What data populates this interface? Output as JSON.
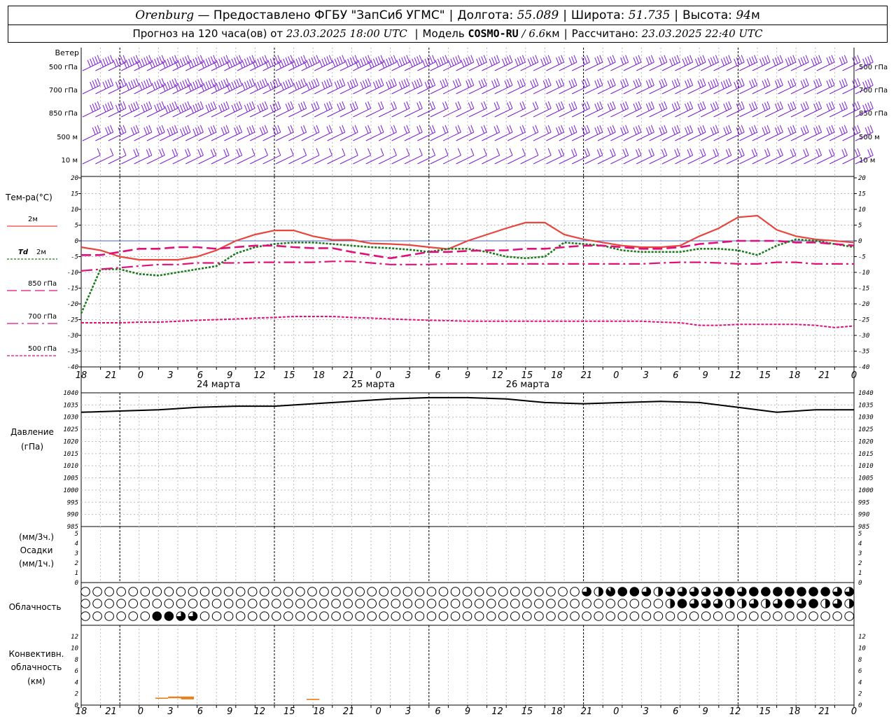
{
  "header": {
    "city": "Orenburg",
    "provider": "— Предоставлено ФГБУ \"ЗапСиб УГМС\"",
    "lon_label": "Долгота:",
    "lon": "55.089",
    "lat_label": "Широта:",
    "lat": "51.735",
    "alt_label": "Высота:",
    "alt": "94",
    "alt_unit": "м",
    "forecast_prefix": "Прогноз на 120 часа(ов) от",
    "forecast_start": "23.03.2025 18:00 UTC",
    "model_label": "Модель",
    "model": "COSMO-RU",
    "resolution_sep": "/",
    "resolution": "6.6",
    "resolution_unit": "км",
    "computed_label": "Рассчитано:",
    "computed": "23.03.2025 22:40 UTC"
  },
  "colors": {
    "t2m": "#e8453c",
    "td2m": "#1a7a1a",
    "t850": "#e0107a",
    "t700": "#e0107a",
    "t500": "#e0107a",
    "zero_line": "#4466dd",
    "wind": "#7a1ad4",
    "pressure": "#000000",
    "convective": "#e88020",
    "grid": "#000000"
  },
  "time_axis": {
    "hour_ticks": [
      "18",
      "21",
      "0",
      "3",
      "6",
      "9",
      "12",
      "15",
      "18",
      "21",
      "0",
      "3",
      "6",
      "9",
      "12",
      "15",
      "18",
      "21",
      "0",
      "3",
      "6",
      "9",
      "12",
      "15",
      "18",
      "21",
      "0"
    ],
    "day_labels": [
      "24 марта",
      "25 марта",
      "26 марта"
    ]
  },
  "chart_data": [
    {
      "type": "barbs",
      "title": "Ветер",
      "levels": [
        "500 гПа",
        "700 гПа",
        "850 гПа",
        "500 м",
        "10 м"
      ],
      "x_hours": [
        0,
        6,
        12,
        18,
        24,
        30,
        36,
        42,
        48,
        54,
        60,
        66,
        72,
        78,
        84,
        90,
        96,
        102,
        108,
        114,
        120
      ],
      "speed_ms": [
        [
          18,
          22,
          25,
          25,
          24,
          22,
          20,
          22,
          20,
          18,
          16,
          14,
          12,
          12,
          12,
          14,
          14,
          14,
          14,
          12,
          14
        ],
        [
          16,
          20,
          22,
          22,
          20,
          18,
          16,
          16,
          14,
          12,
          10,
          10,
          10,
          10,
          12,
          12,
          14,
          12,
          12,
          12,
          14
        ],
        [
          14,
          16,
          18,
          16,
          14,
          12,
          10,
          8,
          8,
          6,
          6,
          8,
          10,
          10,
          12,
          12,
          12,
          10,
          10,
          12,
          14
        ],
        [
          10,
          12,
          14,
          12,
          10,
          8,
          8,
          6,
          6,
          6,
          8,
          8,
          10,
          10,
          10,
          12,
          12,
          12,
          10,
          10,
          12
        ],
        [
          5,
          6,
          7,
          6,
          5,
          5,
          4,
          4,
          4,
          3,
          4,
          5,
          6,
          6,
          6,
          7,
          7,
          6,
          6,
          6,
          7
        ]
      ]
    },
    {
      "type": "line",
      "title": "Тем-ра(°С)",
      "ylim": [
        -40,
        20
      ],
      "y_ticks": [
        "20",
        "15",
        "10",
        "5",
        "0",
        "-5",
        "-10",
        "-15",
        "-20",
        "-25",
        "-30",
        "-35",
        "-40"
      ],
      "x_hours": [
        0,
        3,
        6,
        9,
        12,
        15,
        18,
        21,
        24,
        27,
        30,
        33,
        36,
        39,
        42,
        45,
        48,
        51,
        54,
        57,
        60,
        63,
        66,
        69,
        72,
        75,
        78,
        81,
        84,
        87,
        90,
        93,
        96,
        99,
        102,
        105,
        108,
        111,
        114,
        117,
        120
      ],
      "series": [
        {
          "name": "2м",
          "values": [
            -2,
            -3,
            -5,
            -6,
            -6,
            -6,
            -5,
            -3,
            0,
            2,
            3.3,
            3.3,
            1.5,
            0.3,
            0.3,
            -0.8,
            -1,
            -1.3,
            -2,
            -2.6,
            0,
            2,
            4,
            5.8,
            5.8,
            2,
            0.5,
            -0.5,
            -1.5,
            -2,
            -2,
            -1.5,
            1.5,
            4,
            7.5,
            8,
            3.5,
            1.5,
            0.5,
            0,
            -0.5
          ]
        },
        {
          "name": "Td 2м",
          "values": [
            -23,
            -9,
            -9,
            -10.5,
            -11,
            -10,
            -9,
            -8,
            -4,
            -2,
            -1,
            -0.5,
            -0.5,
            -1,
            -1.5,
            -2,
            -2.3,
            -2.8,
            -3.5,
            -2.5,
            -2.5,
            -3.5,
            -5,
            -5.5,
            -5,
            -0.5,
            -1,
            -1.5,
            -3,
            -3.5,
            -3.5,
            -3.5,
            -2.5,
            -2.5,
            -3,
            -4.5,
            -1.5,
            0.5,
            0,
            -1,
            -2
          ]
        },
        {
          "name": "850 гПа",
          "values": [
            -4.5,
            -4.5,
            -3.5,
            -2.5,
            -2.5,
            -2,
            -2,
            -2.5,
            -2,
            -1.5,
            -1.5,
            -2,
            -2.3,
            -2.3,
            -3.5,
            -4.5,
            -5.5,
            -4.5,
            -3.5,
            -3.5,
            -3.2,
            -3,
            -3,
            -2.5,
            -2.5,
            -2,
            -1.5,
            -1.5,
            -2,
            -2.5,
            -2.5,
            -2,
            -1,
            -0.5,
            0,
            0,
            0,
            -0.5,
            -0.5,
            -1,
            -1.5
          ]
        },
        {
          "name": "700 гПа",
          "values": [
            -9.5,
            -9,
            -8.5,
            -8,
            -7.5,
            -7.5,
            -7,
            -7,
            -7,
            -6.8,
            -6.8,
            -6.8,
            -6.8,
            -6.5,
            -6.5,
            -7,
            -7.5,
            -7.5,
            -7.5,
            -7.3,
            -7.3,
            -7.3,
            -7.3,
            -7.3,
            -7.3,
            -7.3,
            -7.3,
            -7.3,
            -7.3,
            -7.3,
            -7,
            -6.8,
            -6.8,
            -7,
            -7.3,
            -7.3,
            -6.8,
            -6.8,
            -7.3,
            -7.3,
            -7.3
          ]
        },
        {
          "name": "500 гПа",
          "values": [
            -26,
            -26,
            -26,
            -25.8,
            -25.8,
            -25.5,
            -25.2,
            -25,
            -24.8,
            -24.5,
            -24.3,
            -24,
            -24,
            -24,
            -24.3,
            -24.5,
            -24.8,
            -25,
            -25.2,
            -25.3,
            -25.5,
            -25.5,
            -25.5,
            -25.5,
            -25.5,
            -25.5,
            -25.5,
            -25.5,
            -25.5,
            -25.5,
            -25.8,
            -26,
            -26.8,
            -26.8,
            -26.5,
            -26.5,
            -26.5,
            -26.5,
            -26.8,
            -27.5,
            -27
          ]
        }
      ]
    },
    {
      "type": "line",
      "title": "Давление",
      "subtitle": "(гПа)",
      "ylim": [
        985,
        1040
      ],
      "y_ticks": [
        "1040",
        "1035",
        "1030",
        "1025",
        "1020",
        "1015",
        "1010",
        "1005",
        "1000",
        "995",
        "990",
        "985"
      ],
      "x_hours": [
        0,
        6,
        12,
        18,
        24,
        30,
        36,
        42,
        48,
        54,
        60,
        66,
        72,
        78,
        84,
        90,
        96,
        102,
        108,
        114,
        120
      ],
      "series": [
        {
          "name": "",
          "values": [
            1032,
            1032.5,
            1033,
            1034,
            1034.5,
            1034.5,
            1035.5,
            1036.5,
            1037.5,
            1038,
            1038,
            1037.5,
            1036,
            1035.5,
            1036,
            1036.5,
            1036,
            1034,
            1032,
            1033,
            1033
          ]
        }
      ]
    },
    {
      "type": "bar",
      "title": "Осадки",
      "units_top": "(мм/3ч.)",
      "units_bottom": "(мм/1ч.)",
      "ylim": [
        0,
        5
      ],
      "y_ticks": [
        "5",
        "4",
        "3",
        "2",
        "1",
        "0"
      ],
      "x_hours": [
        0,
        120
      ],
      "series": [
        {
          "name": "",
          "values": [
            0,
            0
          ]
        }
      ]
    },
    {
      "type": "table",
      "title": "Облачность",
      "rows_octas": [
        [
          0,
          0,
          0,
          0,
          0,
          0,
          0,
          0,
          0,
          0,
          0,
          0,
          0,
          0,
          0,
          0,
          0,
          0,
          0,
          0,
          0,
          0,
          0,
          0,
          0,
          0,
          0,
          0,
          0,
          0,
          0,
          0,
          0,
          0,
          0,
          0,
          0,
          0,
          0,
          0,
          0,
          0,
          0,
          0,
          0,
          0,
          0,
          0,
          0,
          0,
          0,
          0,
          0,
          0,
          0,
          0,
          0,
          0,
          0,
          0,
          0,
          0,
          0,
          0,
          0,
          0,
          0,
          0,
          0,
          0,
          0,
          0,
          0,
          0,
          0,
          0,
          0,
          0,
          0,
          0,
          0,
          0,
          0,
          0,
          0,
          0,
          0,
          0,
          0,
          0,
          0,
          0,
          0,
          0,
          0,
          0,
          0,
          0,
          0,
          0,
          0,
          0,
          0,
          0,
          0,
          0,
          0,
          0,
          0,
          0,
          0,
          0,
          0,
          0,
          0,
          0,
          0,
          0,
          0,
          0,
          0
        ],
        [
          0,
          0,
          0,
          0,
          0,
          0,
          0,
          0,
          0,
          0,
          0,
          0,
          0,
          0,
          0,
          0,
          0,
          0,
          0,
          0,
          0,
          0,
          0,
          0,
          0,
          0,
          0,
          0,
          0,
          0,
          0,
          0,
          0,
          0,
          0,
          0,
          0,
          0,
          0,
          0,
          0,
          0,
          0,
          0,
          0,
          0,
          0,
          0,
          0,
          0,
          0,
          0,
          0,
          0,
          0,
          0,
          0,
          0,
          0,
          0,
          0,
          0,
          0,
          0,
          0,
          0,
          0,
          0,
          0,
          0,
          0,
          0,
          0,
          0,
          0,
          0,
          0,
          0,
          0,
          0,
          0,
          0,
          0,
          0,
          0,
          0,
          0,
          0,
          0,
          0,
          0,
          0,
          0,
          0,
          0,
          0,
          0,
          0,
          0,
          0,
          0,
          0,
          0,
          0,
          0,
          0,
          0,
          0,
          0,
          0,
          0,
          0,
          0,
          0,
          0,
          0,
          0,
          0,
          0,
          0,
          0
        ],
        [
          0,
          0,
          0,
          0,
          0,
          0,
          0,
          0,
          0,
          0,
          0,
          0,
          0,
          0,
          0,
          0,
          0,
          0,
          0,
          0,
          0,
          0,
          0,
          0,
          0,
          0,
          0,
          0,
          0,
          0,
          0,
          0,
          0,
          0,
          0,
          0,
          0,
          0,
          0,
          0,
          0,
          0,
          0,
          0,
          0,
          0,
          0,
          0,
          0,
          0,
          0,
          0,
          0,
          0,
          0,
          0,
          0,
          0,
          0,
          0,
          0,
          0,
          0,
          0,
          0,
          0,
          0,
          0,
          0,
          0,
          0,
          0,
          0,
          0,
          0,
          0,
          0,
          0,
          0,
          0,
          0,
          0,
          0,
          0,
          0,
          0,
          0,
          0,
          0,
          0,
          0,
          0,
          0,
          0,
          0,
          0,
          0,
          0,
          0,
          0,
          0,
          0,
          0,
          0,
          0,
          0,
          0,
          0,
          0,
          0,
          0,
          0,
          0,
          0,
          0,
          0,
          0,
          0,
          0,
          0,
          0
        ]
      ],
      "high_cloud": {
        "from_hour": 77,
        "to_hour": 120,
        "octas": [
          2,
          6,
          6,
          4,
          8,
          7,
          8,
          8,
          8,
          8,
          8,
          6,
          8,
          4,
          6,
          4,
          6,
          8,
          6,
          4,
          6,
          6,
          6,
          8,
          8,
          6,
          6,
          8,
          8,
          8,
          6,
          8,
          8,
          8,
          8,
          8,
          8,
          8,
          6,
          8,
          8,
          6,
          6,
          6
        ]
      },
      "mid_cloud": {
        "from_hour": 91,
        "to_hour": 120,
        "octas": [
          4,
          8,
          8,
          8,
          6,
          8,
          6,
          4,
          6,
          8,
          4,
          6,
          4,
          8,
          6,
          4,
          6,
          6,
          8,
          8,
          8,
          6,
          6,
          8,
          6,
          4,
          6,
          6,
          4,
          4
        ]
      },
      "low_cloud": {
        "from_hour": 8,
        "to_hour": 18,
        "octas": [
          2,
          4,
          0,
          6,
          8,
          8,
          8,
          8,
          8,
          8,
          6,
          2,
          0,
          6,
          4,
          4,
          6,
          4,
          6,
          0
        ]
      }
    },
    {
      "type": "bar",
      "title": "Конвективн.",
      "subtitle": "облачность",
      "units": "(км)",
      "ylim": [
        0,
        13
      ],
      "y_ticks": [
        "12",
        "10",
        "8",
        "6",
        "4",
        "2",
        "0"
      ],
      "segments": [
        {
          "from_hour": 11.5,
          "to_hour": 13.5,
          "base": 1.1,
          "top": 1.3
        },
        {
          "from_hour": 13.5,
          "to_hour": 15.5,
          "base": 1.2,
          "top": 1.5
        },
        {
          "from_hour": 15.5,
          "to_hour": 17.5,
          "base": 1.0,
          "top": 1.5
        },
        {
          "from_hour": 35,
          "to_hour": 37,
          "base": 0.9,
          "top": 1.1
        }
      ]
    }
  ]
}
